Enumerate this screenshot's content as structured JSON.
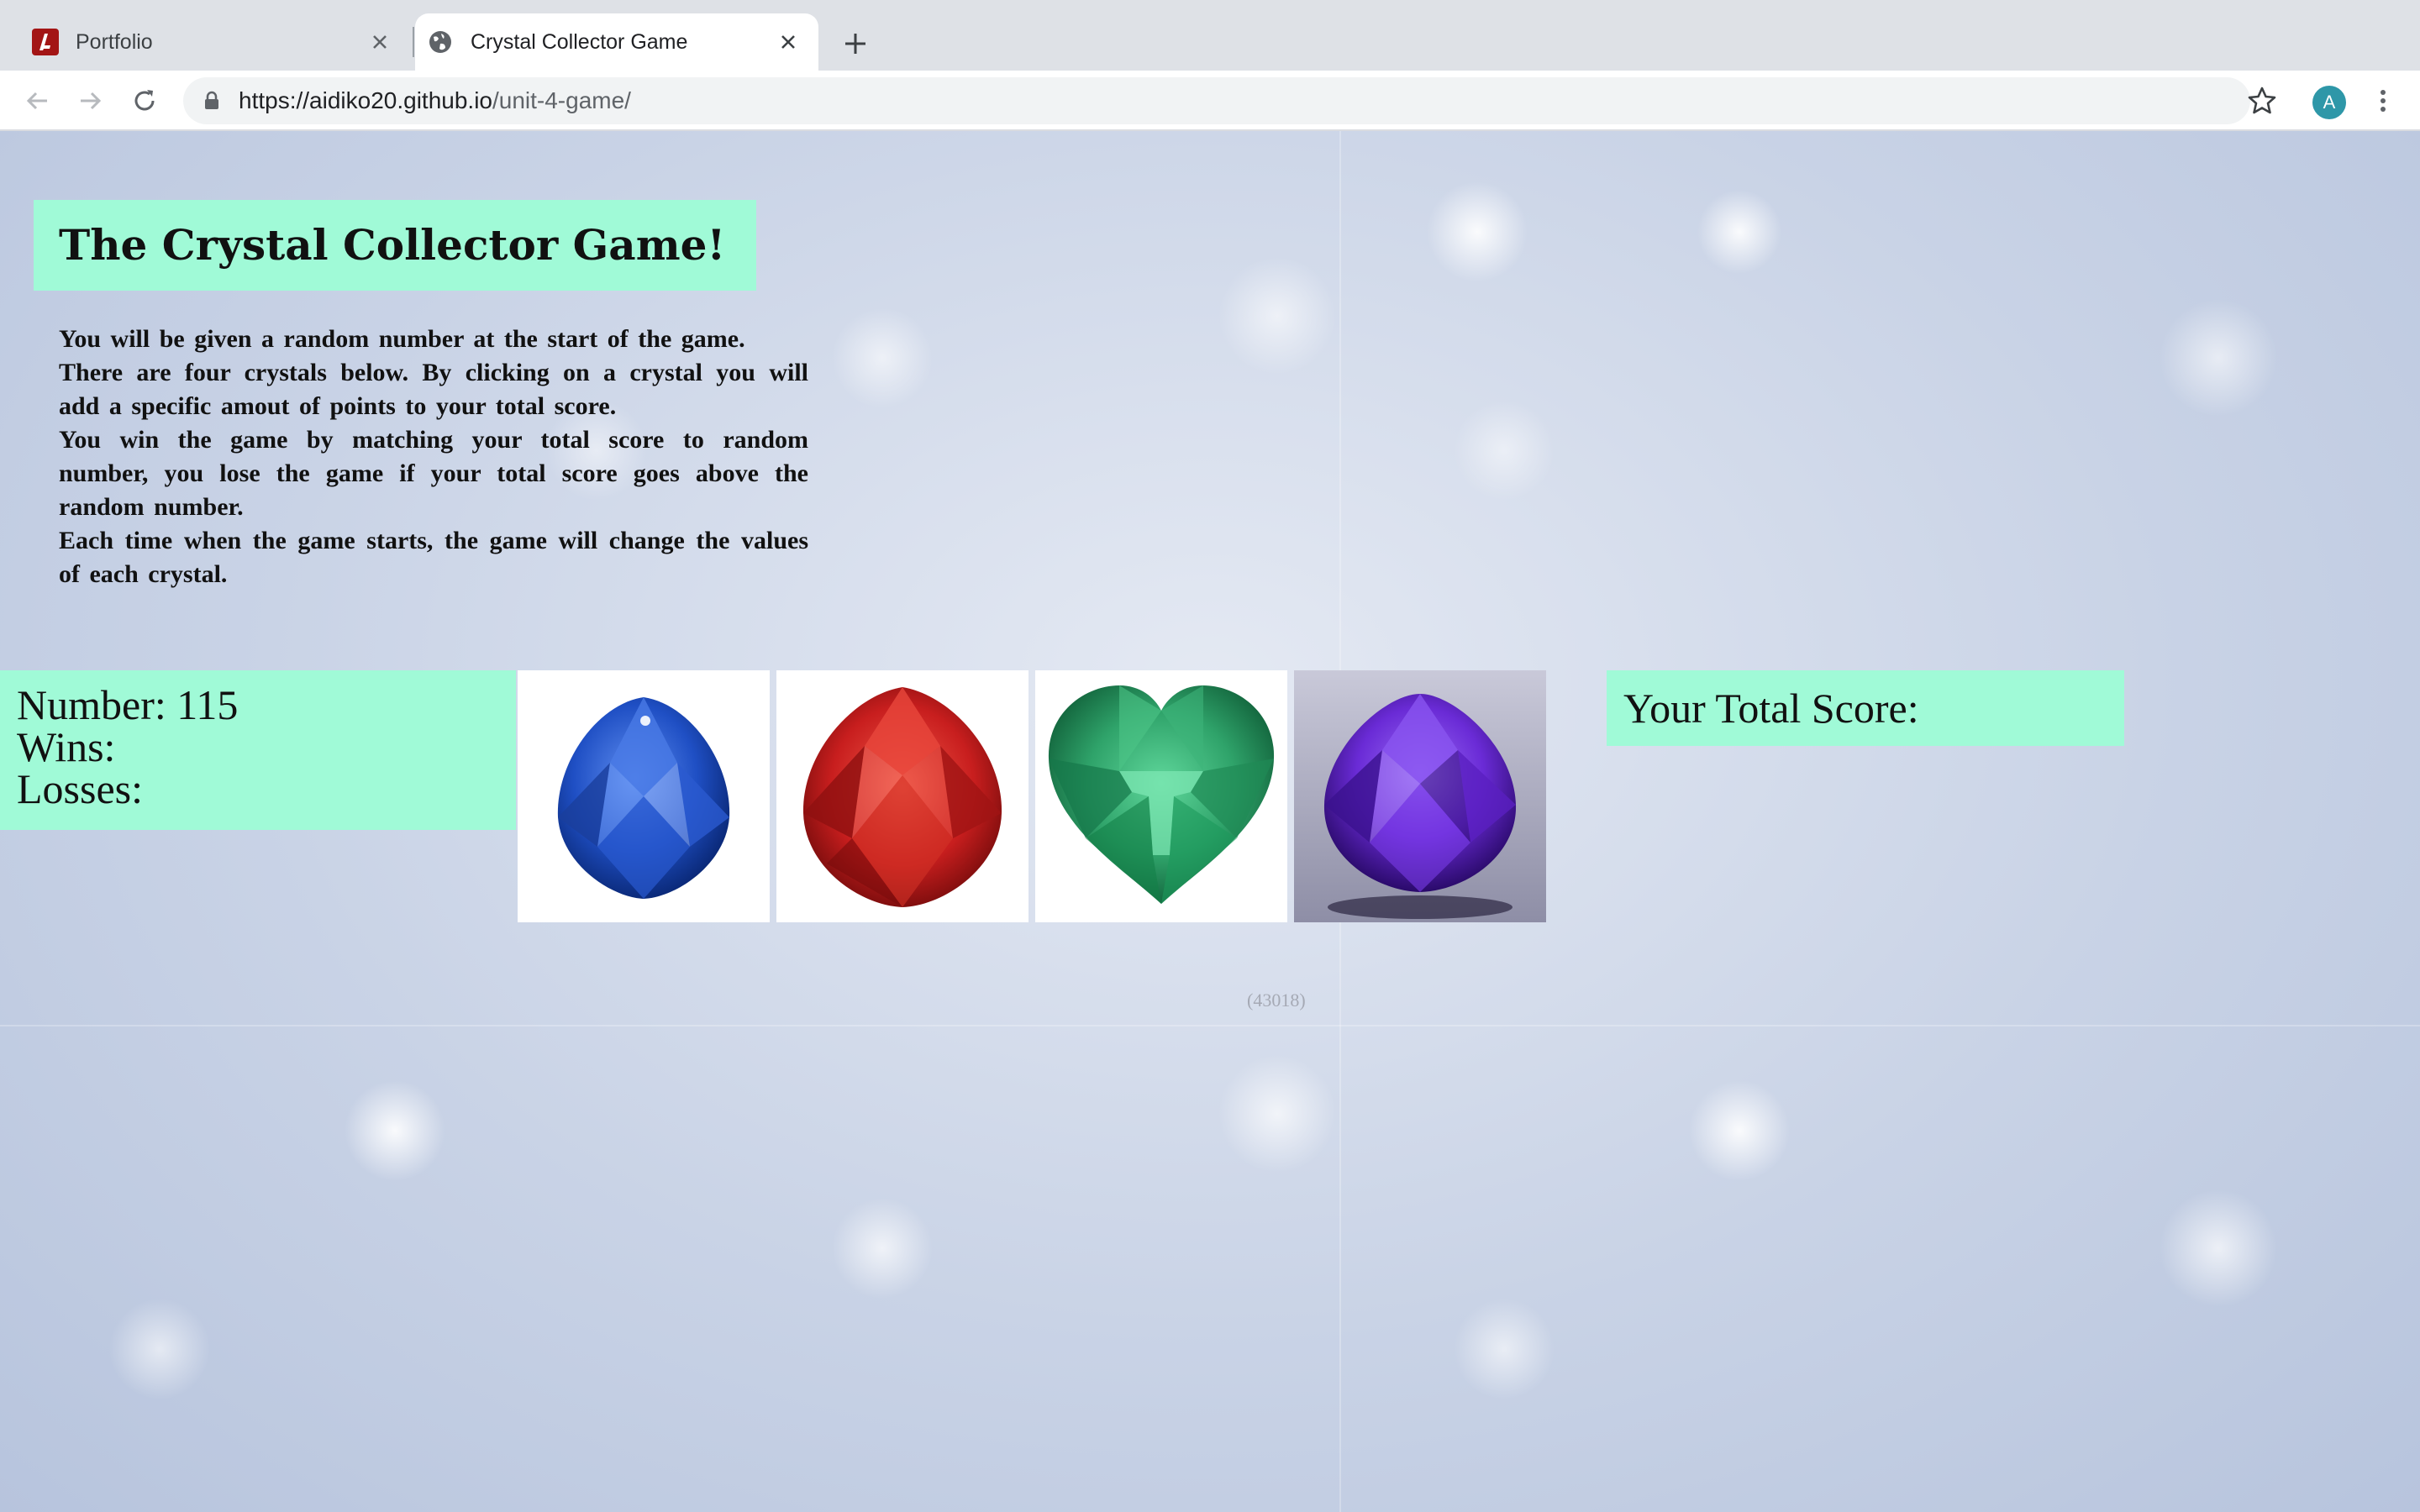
{
  "browser": {
    "tabs": [
      {
        "title": "Portfolio",
        "icon": "portfolio-favicon-icon",
        "active": false
      },
      {
        "title": "Crystal Collector Game",
        "icon": "globe-icon",
        "active": true
      }
    ],
    "url_host": "https://aidiko20.github.io",
    "url_path": "/unit-4-game/",
    "profile_initial": "A"
  },
  "page": {
    "title": "The Crystal Collector Game!",
    "instructions": [
      "You will be given a random number at the start of the game.",
      "There are four crystals below. By clicking on a crystal you will add a specific amout of points to your total score.",
      "You win the game by matching your total score to random number, you lose the game if your total score goes above the random number.",
      "Each time when the game starts, the game will change the values of each crystal."
    ],
    "number_label": "Number: 115",
    "wins_label": "Wins:",
    "losses_label": "Losses:",
    "score_label": "Your Total Score:",
    "crystals": [
      {
        "name": "blue-crystal",
        "color": "#1f4fc4"
      },
      {
        "name": "red-crystal",
        "color": "#c81e1e"
      },
      {
        "name": "green-crystal",
        "color": "#2fa36a"
      },
      {
        "name": "purple-crystal",
        "color": "#6a2bd6"
      }
    ],
    "watermark": "(43018)",
    "colors": {
      "panel": "#a0fad7"
    }
  }
}
